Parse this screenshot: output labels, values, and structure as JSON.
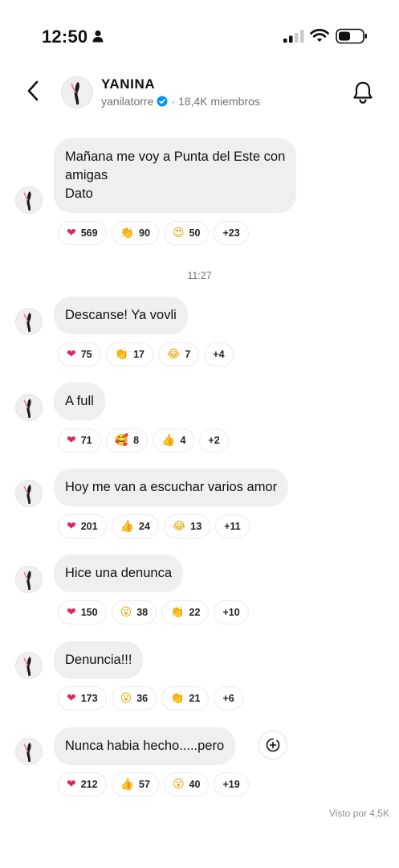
{
  "status_bar": {
    "time": "12:50"
  },
  "header": {
    "title": "YANINA",
    "username": "yanilatorre",
    "members": "· 18,4K miembros"
  },
  "timestamp": "11:27",
  "messages": [
    {
      "lines": [
        "Mañana me voy a Punta del Este con",
        "amigas",
        "Dato"
      ],
      "reactions": [
        {
          "emoji": "❤",
          "count": "569",
          "color": "#e0245e"
        },
        {
          "emoji": "👏",
          "count": "90",
          "color": "#e8a600"
        },
        {
          "emoji": "😍",
          "count": "50",
          "color": "#e8a600"
        },
        {
          "emoji": "",
          "count": "+23"
        }
      ]
    },
    {
      "lines": [
        "Descanse! Ya vovli"
      ],
      "reactions": [
        {
          "emoji": "❤",
          "count": "75",
          "color": "#e0245e"
        },
        {
          "emoji": "👏",
          "count": "17",
          "color": "#e8a600"
        },
        {
          "emoji": "😂",
          "count": "7",
          "color": "#e8a600"
        },
        {
          "emoji": "",
          "count": "+4"
        }
      ]
    },
    {
      "lines": [
        "A full"
      ],
      "reactions": [
        {
          "emoji": "❤",
          "count": "71",
          "color": "#e0245e"
        },
        {
          "emoji": "🥰",
          "count": "8",
          "color": "#e8a600"
        },
        {
          "emoji": "👍",
          "count": "4",
          "color": "#e8a600"
        },
        {
          "emoji": "",
          "count": "+2"
        }
      ]
    },
    {
      "lines": [
        "Hoy me van a escuchar varios amor"
      ],
      "reactions": [
        {
          "emoji": "❤",
          "count": "201",
          "color": "#e0245e"
        },
        {
          "emoji": "👍",
          "count": "24",
          "color": "#e8a600"
        },
        {
          "emoji": "😂",
          "count": "13",
          "color": "#e8a600"
        },
        {
          "emoji": "",
          "count": "+11"
        }
      ]
    },
    {
      "lines": [
        "Hice una denunca"
      ],
      "reactions": [
        {
          "emoji": "❤",
          "count": "150",
          "color": "#e0245e"
        },
        {
          "emoji": "😮",
          "count": "38",
          "color": "#e8a600"
        },
        {
          "emoji": "👏",
          "count": "22",
          "color": "#e8a600"
        },
        {
          "emoji": "",
          "count": "+10"
        }
      ]
    },
    {
      "lines": [
        "Denuncia!!!"
      ],
      "reactions": [
        {
          "emoji": "❤",
          "count": "173",
          "color": "#e0245e"
        },
        {
          "emoji": "😮",
          "count": "36",
          "color": "#e8a600"
        },
        {
          "emoji": "👏",
          "count": "21",
          "color": "#e8a600"
        },
        {
          "emoji": "",
          "count": "+6"
        }
      ]
    },
    {
      "lines": [
        "Nunca habia hecho.....pero"
      ],
      "reactions": [
        {
          "emoji": "❤",
          "count": "212",
          "color": "#e0245e"
        },
        {
          "emoji": "👍",
          "count": "57",
          "color": "#e8a600"
        },
        {
          "emoji": "😮",
          "count": "40",
          "color": "#e8a600"
        },
        {
          "emoji": "",
          "count": "+19"
        }
      ]
    }
  ],
  "seen": "Visto por 4,5K"
}
